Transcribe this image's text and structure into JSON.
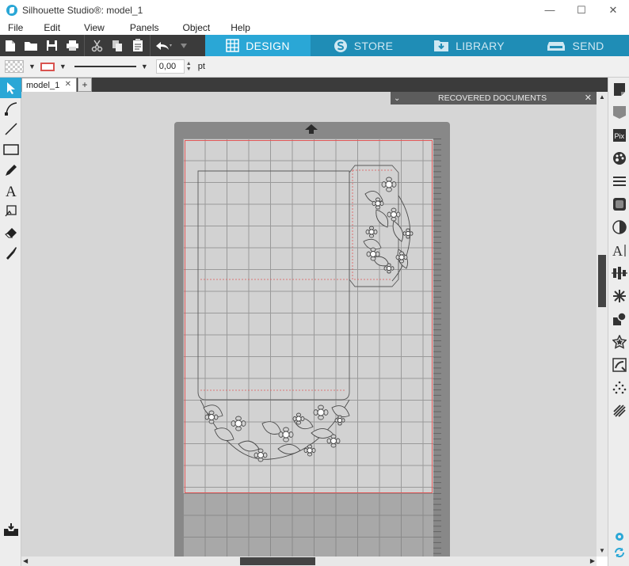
{
  "window": {
    "title": "Silhouette Studio®: model_1",
    "controls": {
      "minimize": "—",
      "maximize": "☐",
      "close": "✕"
    }
  },
  "menu": [
    "File",
    "Edit",
    "View",
    "Panels",
    "Object",
    "Help"
  ],
  "nav_tabs": [
    {
      "label": "DESIGN",
      "icon": "grid-icon",
      "active": true
    },
    {
      "label": "STORE",
      "icon": "store-s-icon",
      "active": false
    },
    {
      "label": "LIBRARY",
      "icon": "download-folder-icon",
      "active": false
    },
    {
      "label": "SEND",
      "icon": "cutter-icon",
      "active": false
    }
  ],
  "line_props": {
    "line_width": "0,00",
    "unit": "pt",
    "line_color": "#d9534f"
  },
  "document": {
    "tab_label": "model_1",
    "tab_close": "✕",
    "add_tab": "+"
  },
  "recovered_panel": {
    "title": "RECOVERED DOCUMENTS",
    "chevron": "⌄",
    "close": "✕"
  },
  "colors": {
    "accent": "#2aa7d6",
    "toolbar": "#3b3b3b",
    "cut_border": "#e05757",
    "canvas": "#d6d6d6"
  },
  "left_tools": [
    "select-arrow-icon",
    "point-edit-icon",
    "line-icon",
    "rectangle-icon",
    "pencil-icon",
    "text-icon",
    "scroll-text-icon",
    "eraser-icon",
    "knife-icon"
  ],
  "right_tools": [
    "page-setup-icon",
    "send-panel-icon",
    "pix-icon",
    "palette-icon",
    "lines-icon",
    "fill-pattern-icon",
    "contrast-icon",
    "text-style-icon",
    "align-icon",
    "replicate-icon",
    "modify-icon",
    "offset-icon",
    "trace-icon",
    "sketch-icon",
    "rhinestone-icon"
  ],
  "right_tools_labels": {
    "pix": "Pix",
    "text_style": "A|"
  }
}
